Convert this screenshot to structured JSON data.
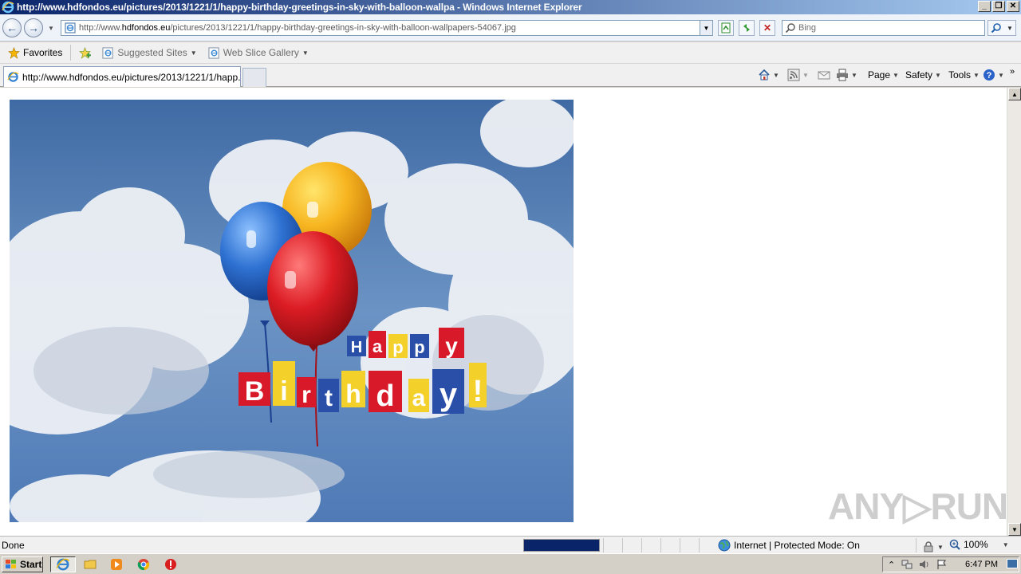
{
  "window": {
    "title": "http://www.hdfondos.eu/pictures/2013/1221/1/happy-birthday-greetings-in-sky-with-balloon-wallpa - Windows Internet Explorer",
    "controls": [
      "_",
      "❐",
      "✕"
    ]
  },
  "address_bar": {
    "url_prefix": "http://www.",
    "url_domain": "hdfondos.eu",
    "url_path": "/pictures/2013/1221/1/happy-birthday-greetings-in-sky-with-balloon-wallpapers-54067.jpg"
  },
  "search": {
    "placeholder": "Bing"
  },
  "favorites_bar": {
    "favorites_label": "Favorites",
    "items": [
      {
        "label": "Suggested Sites"
      },
      {
        "label": "Web Slice Gallery"
      }
    ]
  },
  "tabs": [
    {
      "label": "http://www.hdfondos.eu/pictures/2013/1221/1/happ..."
    }
  ],
  "command_bar": {
    "page_label": "Page",
    "safety_label": "Safety",
    "tools_label": "Tools"
  },
  "content": {
    "image_letters_happy": [
      "H",
      "a",
      "p",
      "p",
      "y"
    ],
    "image_letters_birthday": [
      "B",
      "i",
      "r",
      "t",
      "h",
      "d",
      "a",
      "y",
      "!"
    ],
    "watermark": "ANY▷RUN"
  },
  "status_bar": {
    "status_text": "Done",
    "progress": 1.0,
    "zone_text": "Internet | Protected Mode: On",
    "zoom_text": "100%"
  },
  "taskbar": {
    "start_label": "Start",
    "clock": "6:47 PM"
  },
  "colors": {
    "title_gradient_start": "#0a246a",
    "title_gradient_end": "#a6caf0",
    "progress_fill": "#0a246a"
  }
}
